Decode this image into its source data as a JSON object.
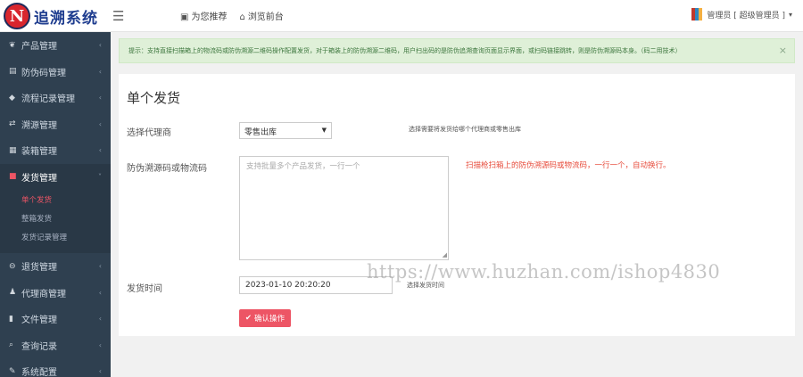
{
  "header": {
    "logo_letter": "N",
    "brand": "追溯系统",
    "menu_icon": "☰",
    "nav": [
      {
        "icon": "home-icon",
        "label": "为您推荐"
      },
      {
        "icon": "home-icon",
        "label": "浏览前台"
      }
    ],
    "user_label": "管理员 [ 超级管理员 ]"
  },
  "sidebar": {
    "items": [
      {
        "label": "产品管理",
        "icon": "leaf-icon"
      },
      {
        "label": "防伪码管理",
        "icon": "barcode-icon"
      },
      {
        "label": "流程记录管理",
        "icon": "tags-icon"
      },
      {
        "label": "溯源管理",
        "icon": "exchange-icon"
      },
      {
        "label": "装箱管理",
        "icon": "grid-icon"
      },
      {
        "label": "发货管理",
        "icon": "truck-icon"
      },
      {
        "label": "退货管理",
        "icon": "minus-circle-icon"
      },
      {
        "label": "代理商管理",
        "icon": "users-icon"
      },
      {
        "label": "文件管理",
        "icon": "file-icon"
      },
      {
        "label": "查询记录",
        "icon": "search-icon"
      },
      {
        "label": "系统配置",
        "icon": "wrench-icon"
      }
    ],
    "sub_items": [
      "单个发货",
      "整箱发货",
      "发货记录管理"
    ]
  },
  "alert": {
    "text": "提示：支持直接扫描箱上的物流码或防伪溯源二维码操作配置发货，对于箱装上的防伪溯源二维码，用户扫出码的是防伪追溯查询页面显示界面，或扫码链接跳转，则是防伪溯源码本身。（码二用技术）",
    "close": "×"
  },
  "form": {
    "title": "单个发货",
    "agent_label": "选择代理商",
    "agent_value": "零售出库",
    "agent_hint": "选择需要将发货给哪个代理商或零售出库",
    "code_label": "防伪溯源码或物流码",
    "code_placeholder": "支持批量多个产品发货，一行一个",
    "code_hint": "扫描枪扫箱上的防伪溯源码或物流码，一行一个，自动换行。",
    "time_label": "发货时间",
    "time_value": "2023-01-10 20:20:20",
    "time_hint": "选择发货时间",
    "submit_label": "确认操作"
  },
  "watermark": "https://www.huzhan.com/ishop4830"
}
